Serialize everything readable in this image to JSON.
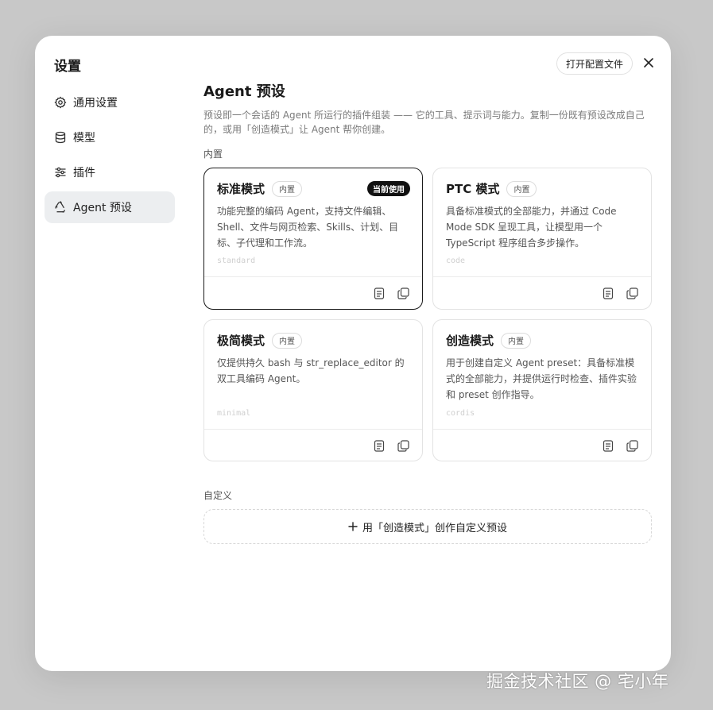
{
  "sidebar": {
    "title": "设置",
    "items": [
      {
        "label": "通用设置",
        "icon": "gear-icon",
        "active": false
      },
      {
        "label": "模型",
        "icon": "database-icon",
        "active": false
      },
      {
        "label": "插件",
        "icon": "sliders-icon",
        "active": false
      },
      {
        "label": "Agent 预设",
        "icon": "recycle-icon",
        "active": true
      }
    ]
  },
  "header": {
    "open_config_label": "打开配置文件",
    "close_icon": "close-icon"
  },
  "main": {
    "title": "Agent 预设",
    "description": "预设即一个会话的 Agent 所运行的插件组装 —— 它的工具、提示词与能力。复制一份既有预设改成自己的，或用「创造模式」让 Agent 帮你创建。",
    "builtin_label": "内置",
    "custom_label": "自定义",
    "create_label": "用「创造模式」创作自定义预设"
  },
  "cards": [
    {
      "title": "标准模式",
      "badge": "内置",
      "current_badge": "当前使用",
      "selected": true,
      "description": "功能完整的编码 Agent，支持文件编辑、Shell、文件与网页检索、Skills、计划、目标、子代理和工作流。",
      "slug": "standard"
    },
    {
      "title": "PTC 模式",
      "badge": "内置",
      "selected": false,
      "description": "具备标准模式的全部能力，并通过 Code Mode SDK 呈现工具，让模型用一个 TypeScript 程序组合多步操作。",
      "slug": "code"
    },
    {
      "title": "极简模式",
      "badge": "内置",
      "selected": false,
      "description": "仅提供持久 bash 与 str_replace_editor 的双工具编码 Agent。",
      "slug": "minimal"
    },
    {
      "title": "创造模式",
      "badge": "内置",
      "selected": false,
      "description": "用于创建自定义 Agent preset：具备标准模式的全部能力，并提供运行时检查、插件实验和 preset 创作指导。",
      "slug": "cordis"
    }
  ],
  "watermark": "掘金技术社区 @ 宅小年",
  "colors": {
    "accent": "#111111",
    "background": "#c8c8c8",
    "active_item": "#eceef0"
  }
}
